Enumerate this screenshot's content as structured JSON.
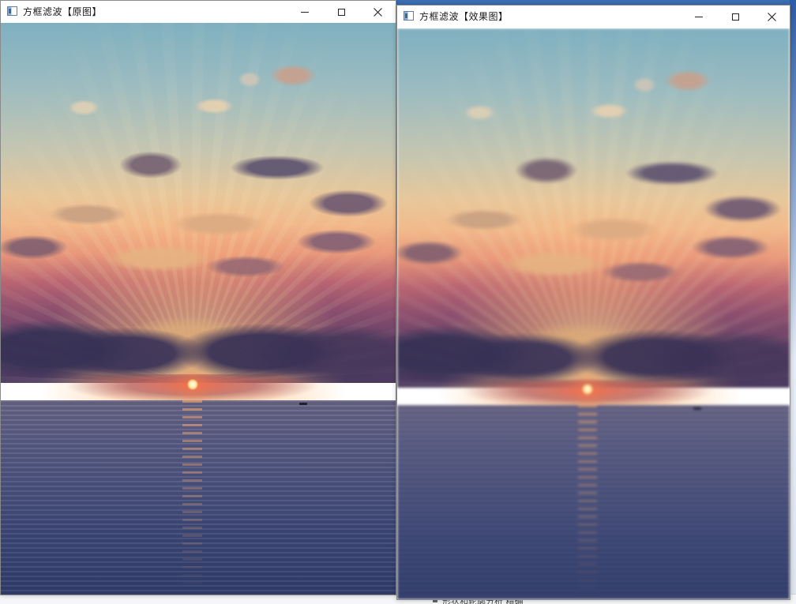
{
  "windows": {
    "original": {
      "title": "方框滤波【原图】",
      "icon": "app-window-icon"
    },
    "result": {
      "title": "方框滤波【效果图】",
      "icon": "app-window-icon"
    }
  },
  "controls": {
    "minimize_icon": "minimize-icon",
    "maximize_icon": "maximize-icon",
    "close_icon": "close-icon"
  },
  "background": {
    "bottom_text": "形状和轮廓分析  精确"
  },
  "colors": {
    "titlebar_bg": "#ffffff",
    "window_border": "#8a8a8a",
    "desktop_accent": "#3b6fb5"
  }
}
